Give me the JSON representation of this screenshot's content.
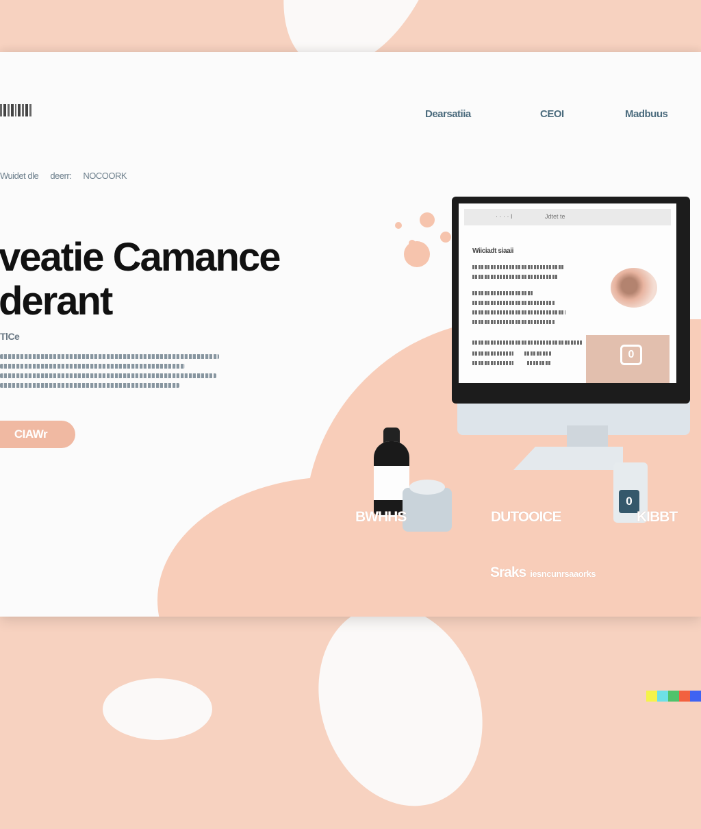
{
  "header": {
    "nav": [
      "Dearsatiia",
      "CEOI",
      "Madbuus"
    ]
  },
  "hero": {
    "tagline": [
      "Wuidet dle",
      "deerr:",
      "NOCOORK"
    ],
    "headline_line1": "veatie Camance",
    "headline_line2": "derant",
    "subhead": "TlCe",
    "cta_label": "CIAWr"
  },
  "screen": {
    "toolbar_left": "· · · · I",
    "toolbar_right": "Jdtet te",
    "title": "Wiiciadt siaaii",
    "box_icon": "0"
  },
  "product": {
    "cup_label": "0"
  },
  "features": [
    "BWHHS",
    "DUTOOICE",
    "KIBBT"
  ],
  "footer": {
    "title": "Sraks",
    "subtitle": "iesncunrsaaorks"
  },
  "colors": {
    "peach": "#f8cdb9",
    "accent": "#f0b9a2",
    "nav_text": "#4b6b7d",
    "headline": "#111111"
  }
}
